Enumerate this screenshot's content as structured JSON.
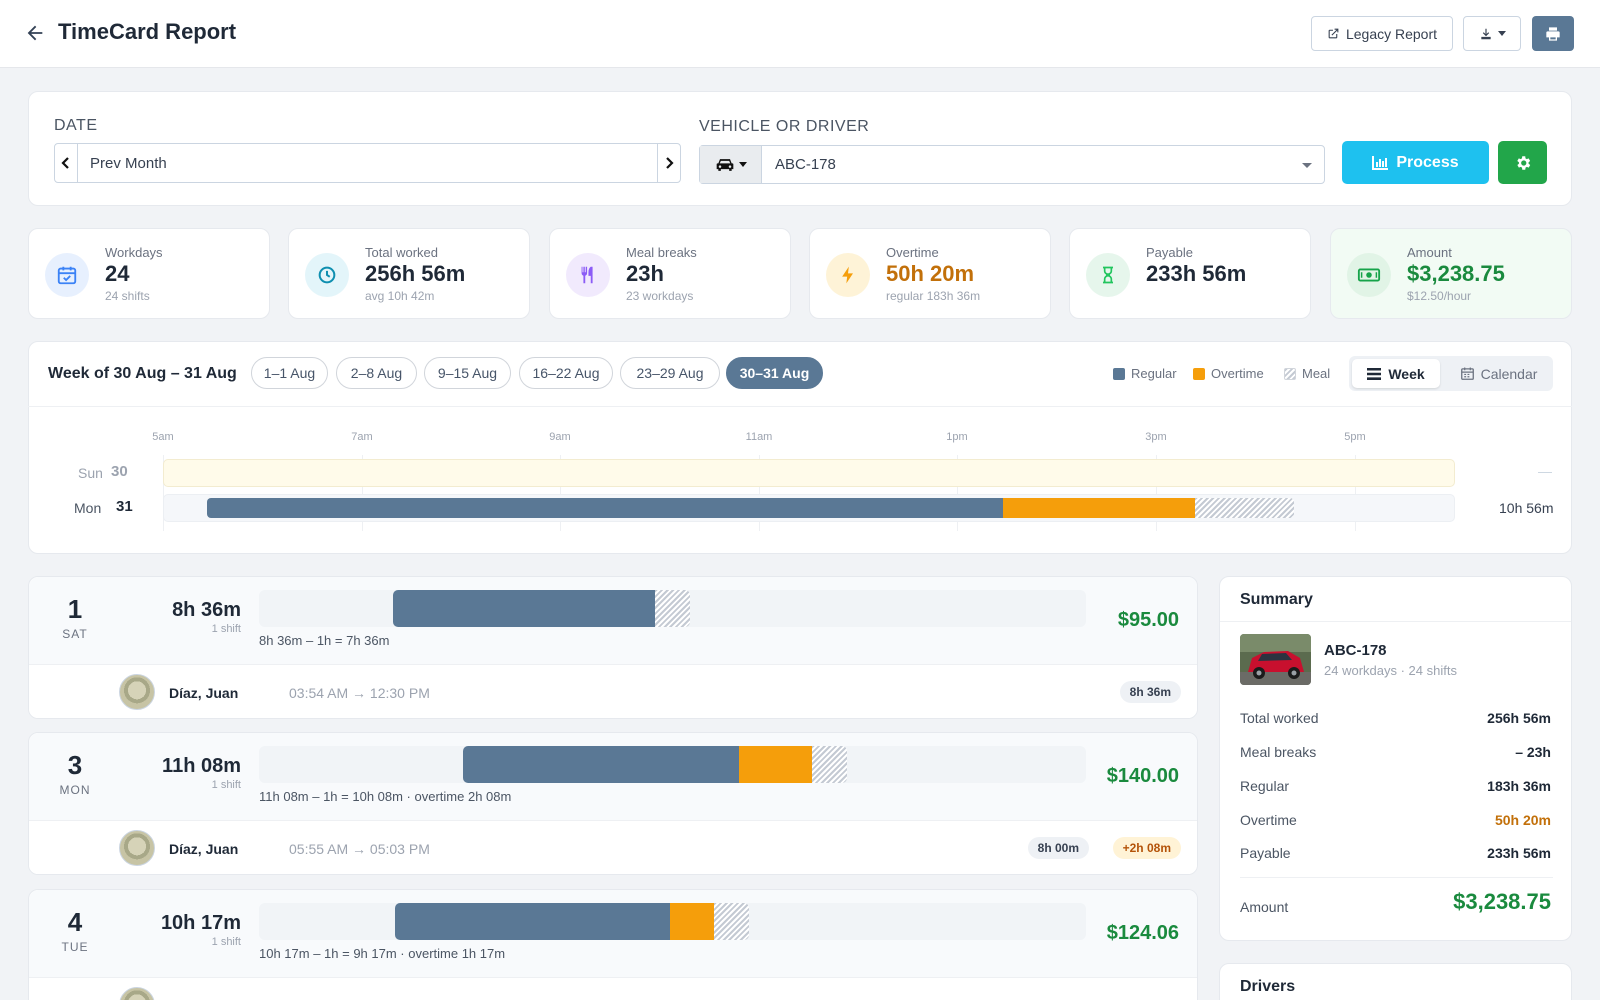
{
  "header": {
    "title": "TimeCard Report",
    "legacy_label": "Legacy Report"
  },
  "filters": {
    "date_label": "DATE",
    "date_value": "Prev Month",
    "vehicle_label": "VEHICLE OR DRIVER",
    "vehicle_value": "ABC-178",
    "process_label": "Process"
  },
  "stats": [
    {
      "label": "Workdays",
      "value": "24",
      "sub": "24 shifts",
      "icon": "calendar-check-icon",
      "color": "#3b82f6"
    },
    {
      "label": "Total worked",
      "value": "256h 56m",
      "sub": "avg 10h 42m",
      "icon": "clock-icon",
      "color": "#0ea5c6"
    },
    {
      "label": "Meal breaks",
      "value": "23h",
      "sub": "23 workdays",
      "icon": "utensils-icon",
      "color": "#8b5cf6"
    },
    {
      "label": "Overtime",
      "value": "50h 20m",
      "sub": "regular 183h 36m",
      "icon": "bolt-icon",
      "color": "#f59e0b"
    },
    {
      "label": "Payable",
      "value": "233h 56m",
      "sub": "",
      "icon": "hourglass-icon",
      "color": "#22c55e"
    },
    {
      "label": "Amount",
      "value": "$3,238.75",
      "sub": "$12.50/hour",
      "icon": "money-icon",
      "color": "#16a34a"
    }
  ],
  "week": {
    "title": "Week of 30 Aug – 31 Aug",
    "pills": [
      "1–1 Aug",
      "2–8 Aug",
      "9–15 Aug",
      "16–22 Aug",
      "23–29 Aug",
      "30–31 Aug"
    ],
    "active_pill": 5,
    "legend": {
      "regular": "Regular",
      "overtime": "Overtime",
      "meal": "Meal"
    },
    "view_week": "Week",
    "view_calendar": "Calendar",
    "ticks": [
      "5am",
      "7am",
      "9am",
      "11am",
      "1pm",
      "3pm",
      "5pm"
    ],
    "days": [
      {
        "dow": "Sun",
        "num": "30",
        "total": "—"
      },
      {
        "dow": "Mon",
        "num": "31",
        "total": "10h 56m"
      }
    ]
  },
  "daily": [
    {
      "num": "1",
      "dow": "SAT",
      "total": "8h 36m",
      "shifts": "1 shift",
      "calc": "8h 36m – 1h = 7h 36m",
      "amount": "$95.00",
      "driver": "Díaz, Juan",
      "times": "03:54 AM → 12:30 PM",
      "badge": "8h 36m",
      "ot_badge": ""
    },
    {
      "num": "3",
      "dow": "MON",
      "total": "11h 08m",
      "shifts": "1 shift",
      "calc": "11h 08m – 1h = 10h 08m · overtime 2h 08m",
      "amount": "$140.00",
      "driver": "Díaz, Juan",
      "times": "05:55 AM → 05:03 PM",
      "badge": "8h 00m",
      "ot_badge": "+2h 08m"
    },
    {
      "num": "4",
      "dow": "TUE",
      "total": "10h 17m",
      "shifts": "1 shift",
      "calc": "10h 17m – 1h = 9h 17m · overtime 1h 17m",
      "amount": "$124.06",
      "driver": "",
      "times": "",
      "badge": "",
      "ot_badge": ""
    }
  ],
  "summary": {
    "title": "Summary",
    "vehicle": "ABC-178",
    "vehicle_sub": "24 workdays · 24 shifts",
    "rows": [
      {
        "label": "Total worked",
        "value": "256h 56m"
      },
      {
        "label": "Meal breaks",
        "value": "– 23h"
      },
      {
        "label": "Regular",
        "value": "183h 36m"
      },
      {
        "label": "Overtime",
        "value": "50h 20m"
      },
      {
        "label": "Payable",
        "value": "233h 56m"
      }
    ],
    "amount_label": "Amount",
    "amount_value": "$3,238.75"
  },
  "drivers": {
    "title": "Drivers"
  },
  "colors": {
    "regular": "#5a7895",
    "overtime": "#f59e0b",
    "accent": "#1ec1ef",
    "money": "#1a8a3e"
  }
}
